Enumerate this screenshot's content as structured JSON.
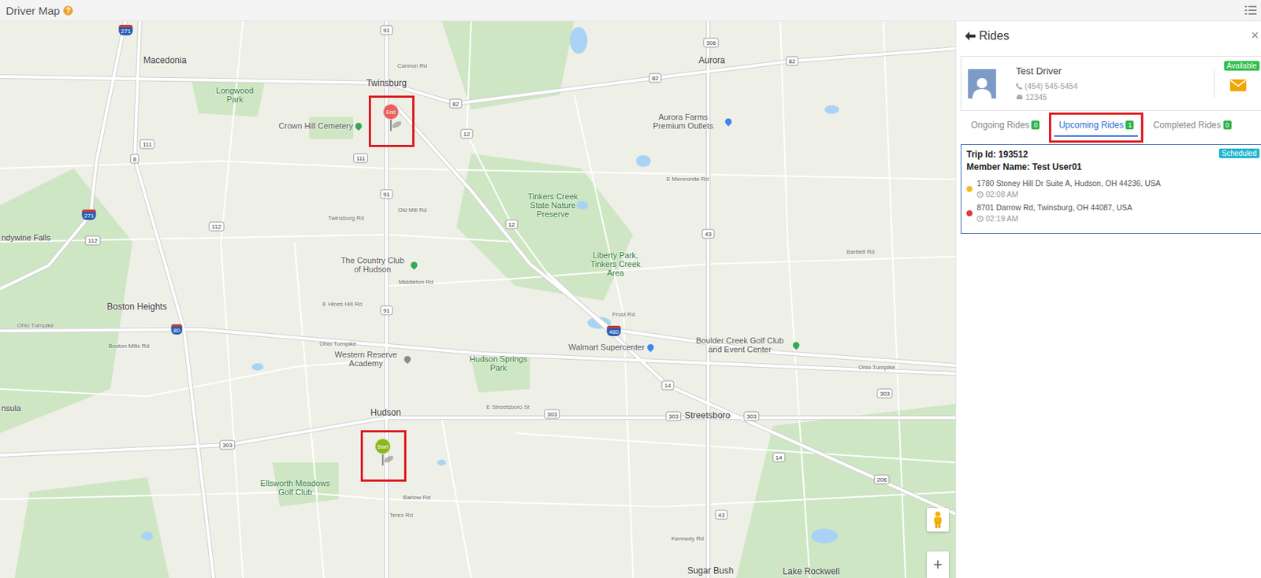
{
  "header": {
    "title": "Driver Map",
    "help": "?"
  },
  "map": {
    "places": [
      {
        "name": "Macedonia",
        "kind": "city"
      },
      {
        "name": "Twinsburg",
        "kind": "city"
      },
      {
        "name": "Aurora",
        "kind": "city"
      },
      {
        "name": "Longwood Park",
        "kind": "park"
      },
      {
        "name": "Crown Hill Cemetery",
        "kind": "poi",
        "color": "#3aa757"
      },
      {
        "name": "Aurora Farms Premium Outlets",
        "kind": "poi",
        "color": "#4285f4"
      },
      {
        "name": "Tinkers Creek State Nature Preserve",
        "kind": "park"
      },
      {
        "name": "Liberty Park, Tinkers Creek Area",
        "kind": "park"
      },
      {
        "name": "The Country Club of Hudson",
        "kind": "poi",
        "color": "#3aa757"
      },
      {
        "name": "Boston Heights",
        "kind": "city"
      },
      {
        "name": "Western Reserve Academy",
        "kind": "poi",
        "color": "#8a8a8a"
      },
      {
        "name": "Hudson Springs Park",
        "kind": "park"
      },
      {
        "name": "Walmart Supercenter",
        "kind": "poi",
        "color": "#4285f4"
      },
      {
        "name": "Boulder Creek Golf Club and Event Center",
        "kind": "poi",
        "color": "#3aa757"
      },
      {
        "name": "Hudson",
        "kind": "city"
      },
      {
        "name": "Streetsboro",
        "kind": "city"
      },
      {
        "name": "Ellsworth Meadows Golf Club",
        "kind": "park"
      },
      {
        "name": "Sugar Bush",
        "kind": "city"
      },
      {
        "name": "Lake Rockwell",
        "kind": "city"
      },
      {
        "name": "ndywine Falls",
        "kind": "edge"
      },
      {
        "name": "nsula",
        "kind": "edge"
      }
    ],
    "roads": [
      "Cannon Rd",
      "Twinsburg Rd",
      "Old Mill Rd",
      "Middleton Rd",
      "E Hines Hill Rd",
      "Frost Rd",
      "E Mennonite Rd",
      "E Streetsboro St",
      "Barlow Rd",
      "Terex Rd",
      "Kennedy Rd",
      "Boston Mills Rd",
      "Bartlett Rd",
      "Ohio Turnpike",
      "Ohio Turnpike",
      "Ohio Turnpike"
    ],
    "shields": [
      {
        "number": "91",
        "kind": "state"
      },
      {
        "number": "82",
        "kind": "state"
      },
      {
        "number": "82",
        "kind": "state"
      },
      {
        "number": "82",
        "kind": "state"
      },
      {
        "number": "306",
        "kind": "state"
      },
      {
        "number": "8",
        "kind": "state"
      },
      {
        "number": "111",
        "kind": "state"
      },
      {
        "number": "111",
        "kind": "state"
      },
      {
        "number": "91",
        "kind": "state"
      },
      {
        "number": "91",
        "kind": "state"
      },
      {
        "number": "12",
        "kind": "state"
      },
      {
        "number": "12",
        "kind": "state"
      },
      {
        "number": "43",
        "kind": "state"
      },
      {
        "number": "14",
        "kind": "state"
      },
      {
        "number": "303",
        "kind": "state"
      },
      {
        "number": "303",
        "kind": "state"
      },
      {
        "number": "303",
        "kind": "state"
      },
      {
        "number": "480",
        "kind": "interstate"
      },
      {
        "number": "80",
        "kind": "interstate"
      },
      {
        "number": "271",
        "kind": "interstate"
      },
      {
        "number": "271",
        "kind": "interstate"
      },
      {
        "number": "303",
        "kind": "state"
      },
      {
        "number": "43",
        "kind": "state"
      },
      {
        "number": "14",
        "kind": "state"
      },
      {
        "number": "303",
        "kind": "state"
      },
      {
        "number": "206",
        "kind": "state"
      },
      {
        "number": "112",
        "kind": "state"
      },
      {
        "number": "112",
        "kind": "state"
      }
    ],
    "markers": [
      {
        "label": "End",
        "color": "#e8615f",
        "highlighted": true
      },
      {
        "label": "Start",
        "color": "#8db61f",
        "highlighted": true
      }
    ],
    "zoom_in": "+"
  },
  "panel": {
    "title": "Rides",
    "close": "×",
    "driver": {
      "name": "Test Driver",
      "phone": "(454) 545-5454",
      "vehicle": "12345",
      "status": "Available"
    },
    "tabs": [
      {
        "label": "Ongoing Rides",
        "count": "0",
        "selected": false,
        "highlighted": false
      },
      {
        "label": "Upcoming Rides",
        "count": "1",
        "selected": true,
        "highlighted": true
      },
      {
        "label": "Completed Rides",
        "count": "0",
        "selected": false,
        "highlighted": false
      }
    ],
    "trips": [
      {
        "trip_id": "Trip Id: 193512",
        "member": "Member Name: Test User01",
        "status": "Scheduled",
        "stops": [
          {
            "address": "1780 Stoney Hill Dr Suite A, Hudson, OH 44236, USA",
            "time": "02:08 AM",
            "color": "#f5b82e"
          },
          {
            "address": "8701 Darrow Rd, Twinsburg, OH 44087, USA",
            "time": "02:19 AM",
            "color": "#e0393e"
          }
        ]
      }
    ]
  }
}
